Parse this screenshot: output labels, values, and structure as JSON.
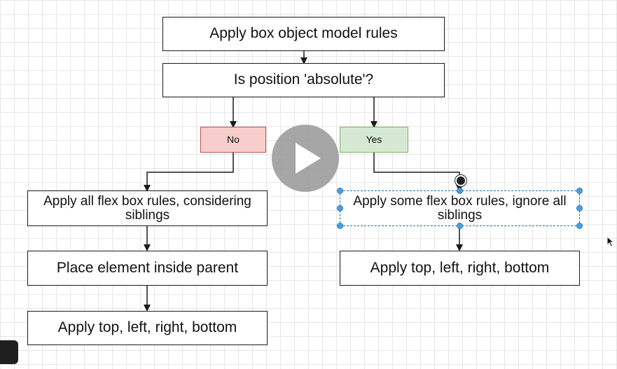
{
  "flowchart": {
    "nodes": {
      "apply_box_model": "Apply box object model rules",
      "is_absolute": "Is position 'absolute'?",
      "no": "No",
      "yes": "Yes",
      "flex_all_line1": "Apply all flex box rules, considering",
      "flex_all_line2": "siblings",
      "flex_some_line1": "Apply some flex box rules, ignore all",
      "flex_some_line2": "siblings",
      "place_inside": "Place element inside parent",
      "apply_tlrb_left": "Apply top, left, right, bottom",
      "apply_tlrb_right": "Apply top, left, right, bottom"
    },
    "colors": {
      "no_fill": "#f8cecc",
      "no_stroke": "#b85450",
      "yes_fill": "#d5e8d4",
      "yes_stroke": "#82b366",
      "selection": "#4a9fe0"
    }
  },
  "player": {
    "icon": "play-icon"
  }
}
